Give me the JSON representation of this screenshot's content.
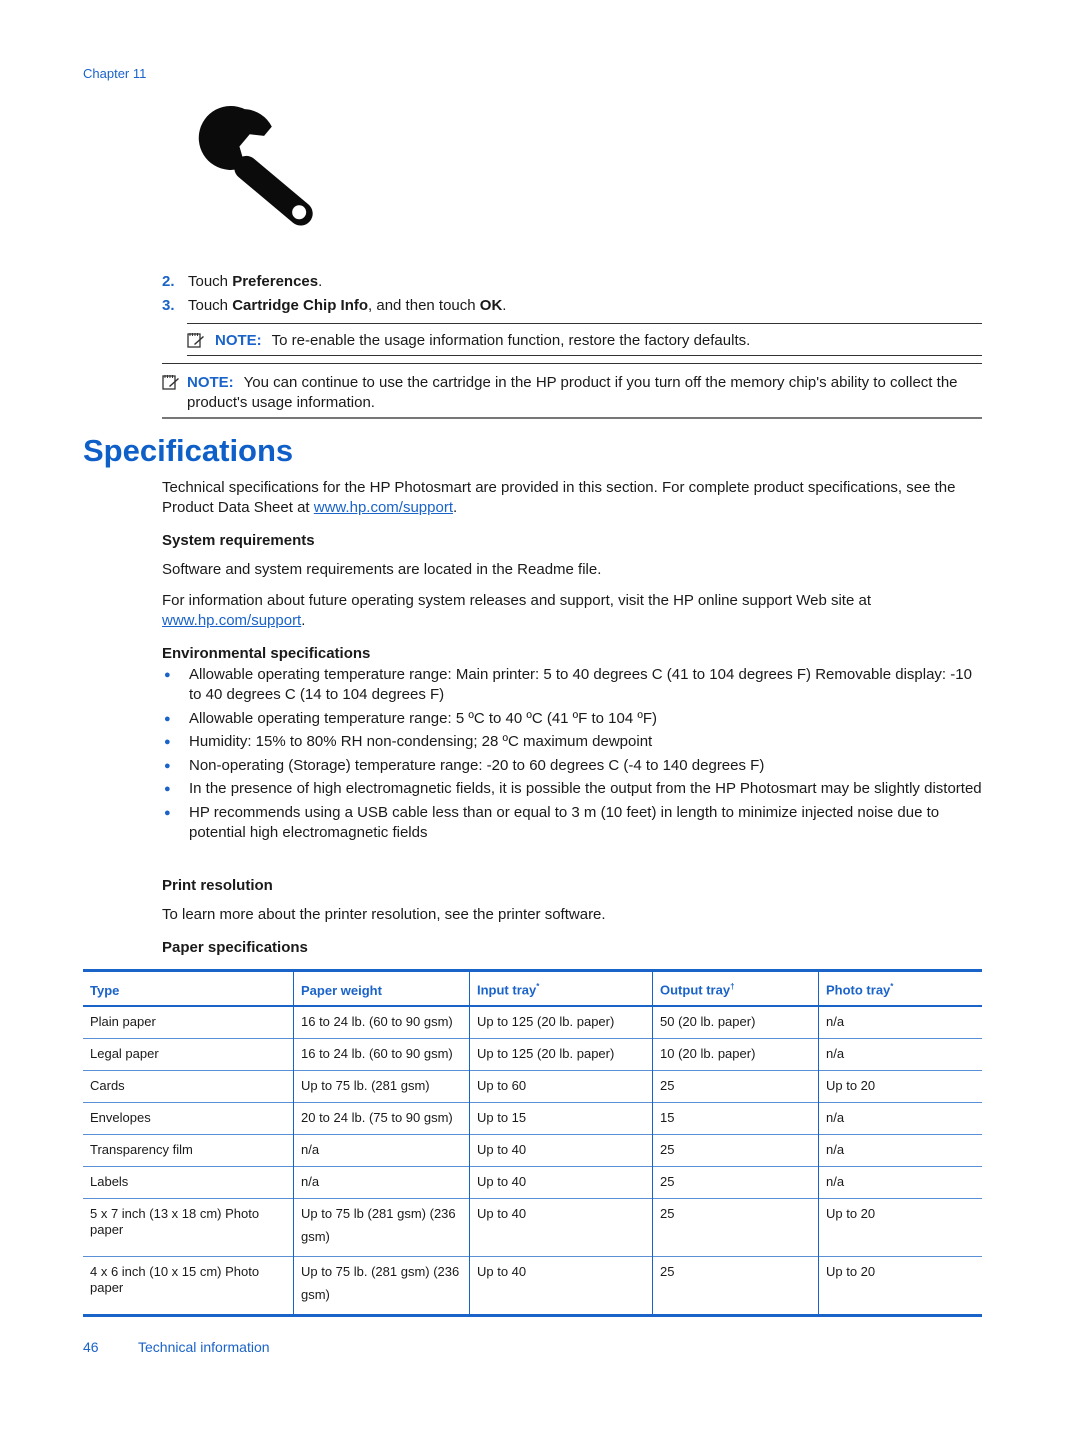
{
  "header": {
    "chapter": "Chapter 11"
  },
  "steps": [
    {
      "num": "2.",
      "prefix": "Touch ",
      "bold": "Preferences",
      "suffix": ".",
      "bold2": "",
      "suffix2": ""
    },
    {
      "num": "3.",
      "prefix": "Touch ",
      "bold": "Cartridge Chip Info",
      "suffix": ", and then touch ",
      "bold2": "OK",
      "suffix2": "."
    }
  ],
  "notes": {
    "inner": {
      "label": "NOTE:",
      "text": "To re-enable the usage information function, restore the factory defaults."
    },
    "outer": {
      "label": "NOTE:",
      "text": "You can continue to use the cartridge in the HP product if you turn off the memory chip's ability to collect the product's usage information."
    }
  },
  "section": {
    "title": "Specifications",
    "intro": "Technical specifications for the HP Photosmart are provided in this section. For complete product specifications, see the Product Data Sheet at ",
    "intro_link": "www.hp.com/support",
    "intro_end": "."
  },
  "system": {
    "heading": "System requirements",
    "p1": "Software and system requirements are located in the Readme file.",
    "p2": "For information about future operating system releases and support, visit the HP online support Web site at ",
    "p2_link": "www.hp.com/support",
    "p2_end": "."
  },
  "environmental": {
    "heading": "Environmental specifications",
    "bullets": [
      "Allowable operating temperature range: Main printer: 5 to 40 degrees C (41 to 104 degrees F) Removable display: -10 to 40 degrees C (14 to 104 degrees F)",
      "Allowable operating temperature range: 5 ºC to 40 ºC (41 ºF to 104 ºF)",
      "Humidity: 15% to 80% RH non-condensing; 28 ºC maximum dewpoint",
      "Non-operating (Storage) temperature range: -20 to 60 degrees C (-4 to 140 degrees F)",
      "In the presence of high electromagnetic fields, it is possible the output from the HP Photosmart may be slightly distorted",
      "HP recommends using a USB cable less than or equal to 3 m (10 feet) in length to minimize injected noise due to potential high electromagnetic fields"
    ]
  },
  "print_resolution": {
    "heading": "Print resolution",
    "text": "To learn more about the printer resolution, see the printer software."
  },
  "paper": {
    "heading": "Paper specifications",
    "columns": [
      {
        "label": "Type",
        "mark": ""
      },
      {
        "label": "Paper weight",
        "mark": ""
      },
      {
        "label": "Input tray",
        "mark": "*"
      },
      {
        "label": "Output tray",
        "mark": "†"
      },
      {
        "label": "Photo tray",
        "mark": "*"
      }
    ],
    "rows": [
      [
        "Plain paper",
        "16 to 24 lb. (60 to 90 gsm)",
        "Up to 125 (20 lb. paper)",
        "50 (20 lb. paper)",
        "n/a"
      ],
      [
        "Legal paper",
        "16 to 24 lb. (60 to 90 gsm)",
        "Up to 125 (20 lb. paper)",
        "10 (20 lb. paper)",
        "n/a"
      ],
      [
        "Cards",
        "Up to 75 lb. (281 gsm)",
        "Up to 60",
        "25",
        "Up to 20"
      ],
      [
        "Envelopes",
        "20 to 24 lb. (75 to 90 gsm)",
        "Up to 15",
        "15",
        "n/a"
      ],
      [
        "Transparency film",
        "n/a",
        "Up to 40",
        "25",
        "n/a"
      ],
      [
        "Labels",
        "n/a",
        "Up to 40",
        "25",
        "n/a"
      ],
      [
        "5 x 7 inch (13 x 18 cm) Photo paper",
        "Up to 75 lb (281 gsm) (236 gsm)",
        "Up to 40",
        "25",
        "Up to 20"
      ],
      [
        "4 x 6 inch (10 x 15 cm) Photo paper",
        "Up to 75 lb. (281 gsm) (236 gsm)",
        "Up to 40",
        "25",
        "Up to 20"
      ]
    ]
  },
  "footer": {
    "page": "46",
    "section": "Technical information"
  },
  "colors": {
    "accent": "#1a63c9",
    "heading": "#0e5fc8",
    "text": "#1a1a1a"
  }
}
